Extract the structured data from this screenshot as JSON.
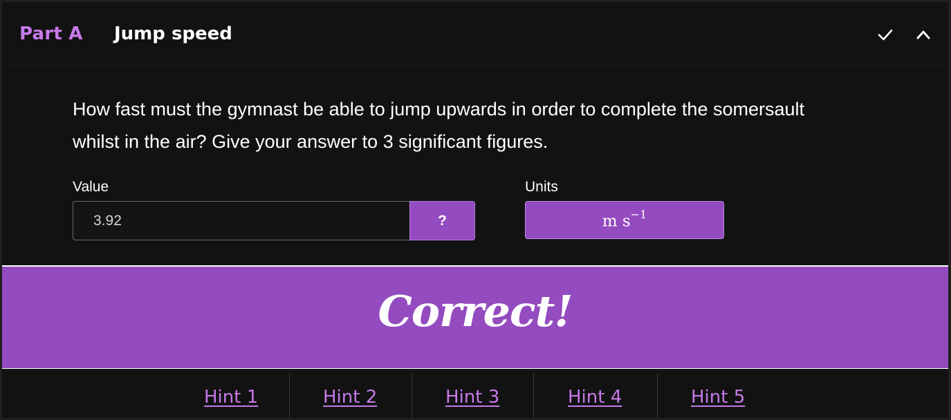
{
  "header": {
    "part_label": "Part A",
    "title": "Jump speed"
  },
  "question": {
    "text": "How fast must the gymnast be able to jump upwards in order to complete the somersault whilst in the air? Give your answer to 3 significant figures."
  },
  "answer": {
    "value_label": "Value",
    "value": "3.92",
    "help_label": "?",
    "units_label": "Units",
    "unit_base": "m s",
    "unit_exponent": "−1"
  },
  "feedback": {
    "text": "Correct!"
  },
  "hints": [
    {
      "label": "Hint 1"
    },
    {
      "label": "Hint 2"
    },
    {
      "label": "Hint 3"
    },
    {
      "label": "Hint 4"
    },
    {
      "label": "Hint 5"
    }
  ],
  "colors": {
    "accent": "#944bbf",
    "accent_text": "#c779e8",
    "background": "#121212"
  },
  "icons": [
    "check-icon",
    "chevron-up-icon"
  ]
}
